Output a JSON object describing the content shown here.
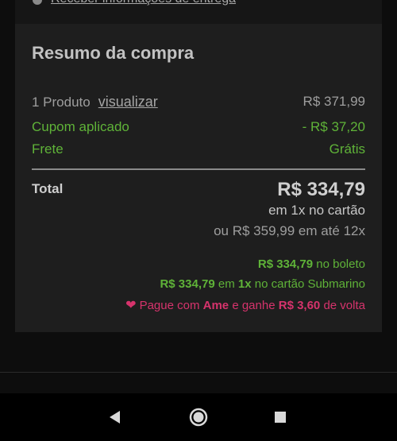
{
  "top": {
    "link_text": "Receber informações de entrega"
  },
  "summary": {
    "title": "Resumo da compra",
    "product_label": "1 Produto",
    "view_link": "visualizar",
    "product_price": "R$ 371,99",
    "coupon_label": "Cupom aplicado",
    "coupon_value": "- R$ 37,20",
    "shipping_label": "Frete",
    "shipping_value": "Grátis",
    "total_label": "Total",
    "total_value": "R$ 334,79",
    "total_sub": "em 1x no cartão",
    "installments": "ou R$ 359,99 em até 12x",
    "boleto_price": "R$ 334,79",
    "boleto_text": "no boleto",
    "card_price": "R$ 334,79",
    "card_mid": "em",
    "card_times": "1x",
    "card_text": "no cartão Submarino",
    "ame_pre": "Pague com",
    "ame_brand": "Ame",
    "ame_mid": "e ganhe",
    "ame_value": "R$ 3,60",
    "ame_post": "de volta"
  },
  "colors": {
    "background": "#0d0d0d",
    "card": "#1e1e1e",
    "green": "#5fb338",
    "pink": "#d6336c"
  },
  "nav": {
    "back_icon": "back-triangle-icon",
    "home_icon": "home-circle-icon",
    "recents_icon": "recents-square-icon"
  }
}
